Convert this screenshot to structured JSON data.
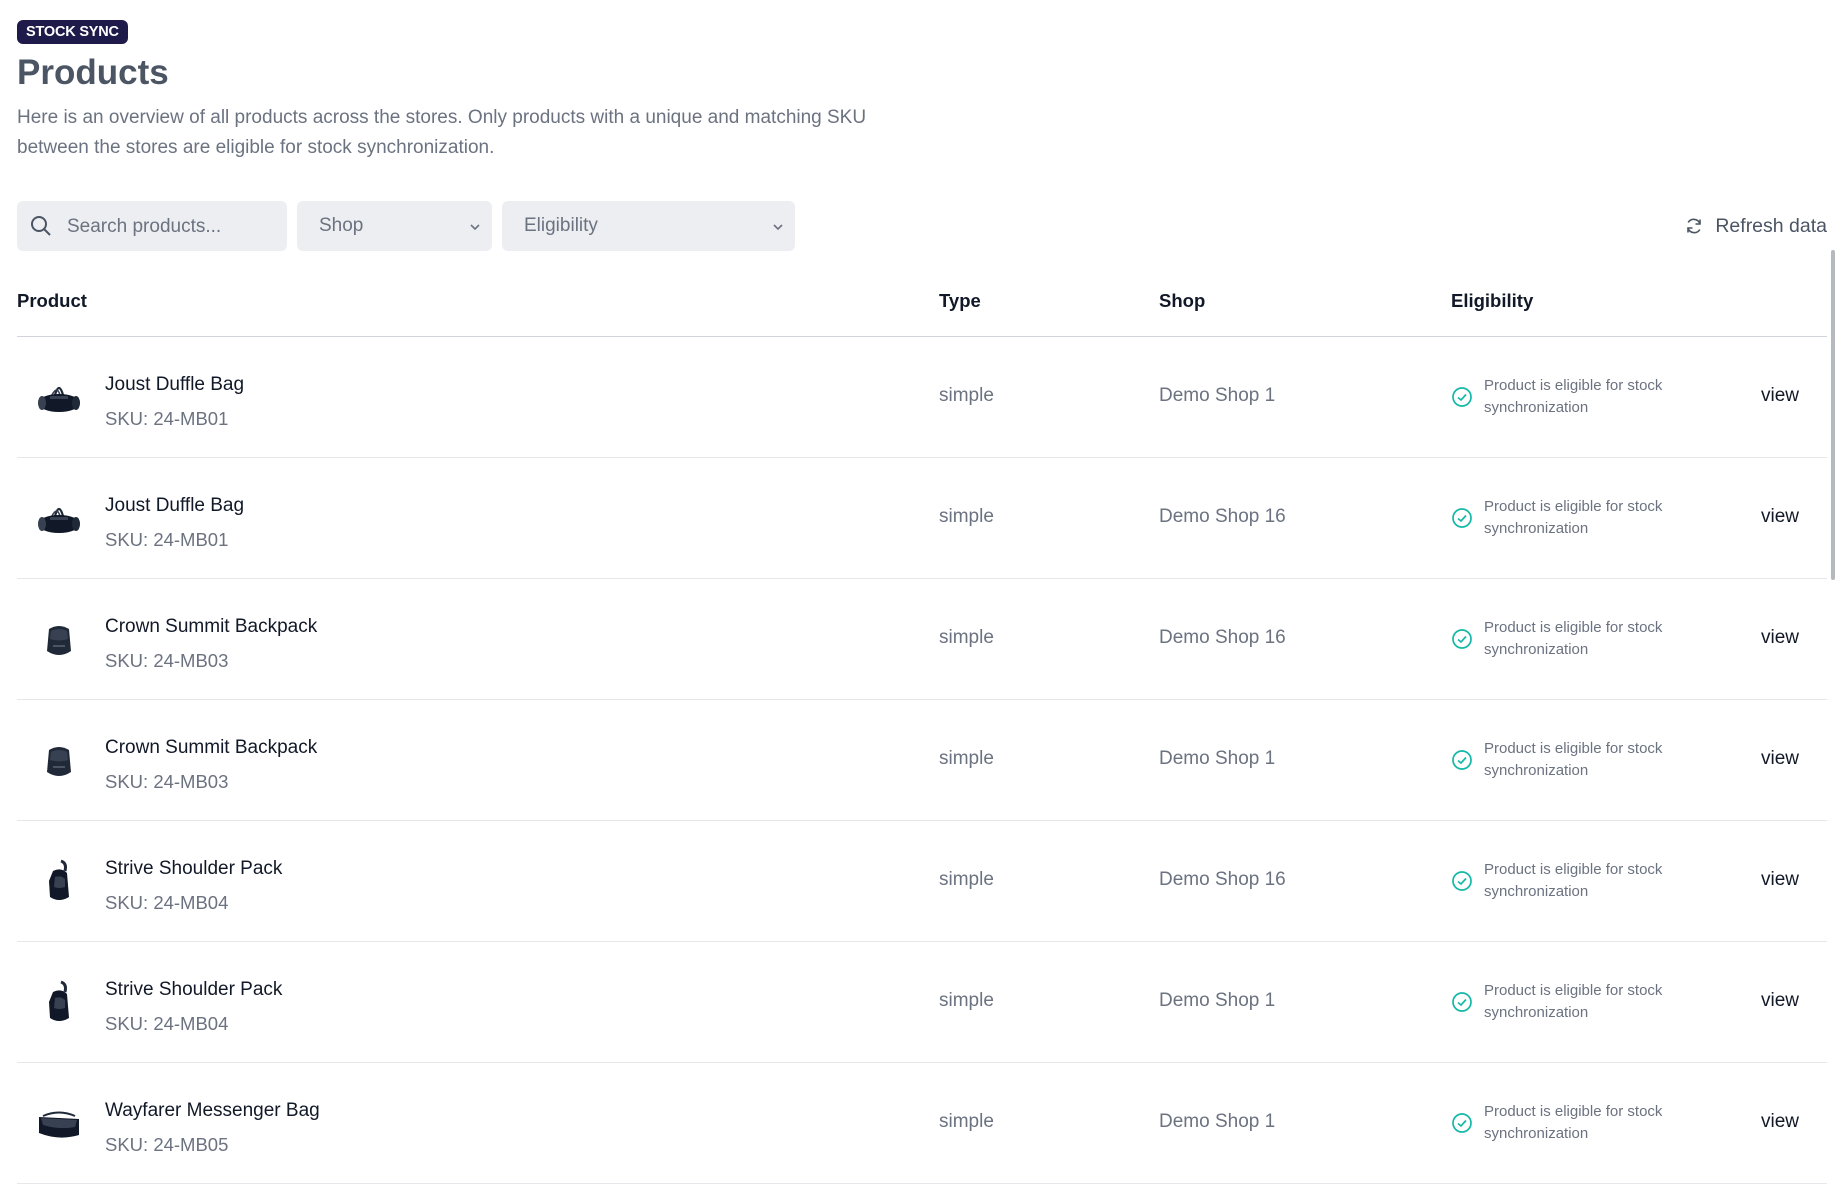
{
  "header": {
    "badge": "STOCK SYNC",
    "title": "Products",
    "description": "Here is an overview of all products across the stores. Only products with a unique and matching SKU between the stores are eligible for stock synchronization."
  },
  "toolbar": {
    "search_placeholder": "Search products...",
    "shop_select": "Shop",
    "eligibility_select": "Eligibility",
    "refresh_label": "Refresh data"
  },
  "table": {
    "headers": {
      "product": "Product",
      "type": "Type",
      "shop": "Shop",
      "eligibility": "Eligibility"
    },
    "rows": [
      {
        "name": "Joust Duffle Bag",
        "sku": "SKU: 24-MB01",
        "type": "simple",
        "shop": "Demo Shop 1",
        "eligibility": "Product is eligible for stock synchronization",
        "action": "view",
        "icon": "duffle-bag-icon"
      },
      {
        "name": "Joust Duffle Bag",
        "sku": "SKU: 24-MB01",
        "type": "simple",
        "shop": "Demo Shop 16",
        "eligibility": "Product is eligible for stock synchronization",
        "action": "view",
        "icon": "duffle-bag-icon"
      },
      {
        "name": "Crown Summit Backpack",
        "sku": "SKU: 24-MB03",
        "type": "simple",
        "shop": "Demo Shop 16",
        "eligibility": "Product is eligible for stock synchronization",
        "action": "view",
        "icon": "backpack-icon"
      },
      {
        "name": "Crown Summit Backpack",
        "sku": "SKU: 24-MB03",
        "type": "simple",
        "shop": "Demo Shop 1",
        "eligibility": "Product is eligible for stock synchronization",
        "action": "view",
        "icon": "backpack-icon"
      },
      {
        "name": "Strive Shoulder Pack",
        "sku": "SKU: 24-MB04",
        "type": "simple",
        "shop": "Demo Shop 16",
        "eligibility": "Product is eligible for stock synchronization",
        "action": "view",
        "icon": "shoulder-pack-icon"
      },
      {
        "name": "Strive Shoulder Pack",
        "sku": "SKU: 24-MB04",
        "type": "simple",
        "shop": "Demo Shop 1",
        "eligibility": "Product is eligible for stock synchronization",
        "action": "view",
        "icon": "shoulder-pack-icon"
      },
      {
        "name": "Wayfarer Messenger Bag",
        "sku": "SKU: 24-MB05",
        "type": "simple",
        "shop": "Demo Shop 1",
        "eligibility": "Product is eligible for stock synchronization",
        "action": "view",
        "icon": "messenger-bag-icon"
      }
    ]
  },
  "colors": {
    "badge_bg": "#1e1b4b",
    "eligible_green": "#14b8a6",
    "muted_text": "#6b7280"
  }
}
